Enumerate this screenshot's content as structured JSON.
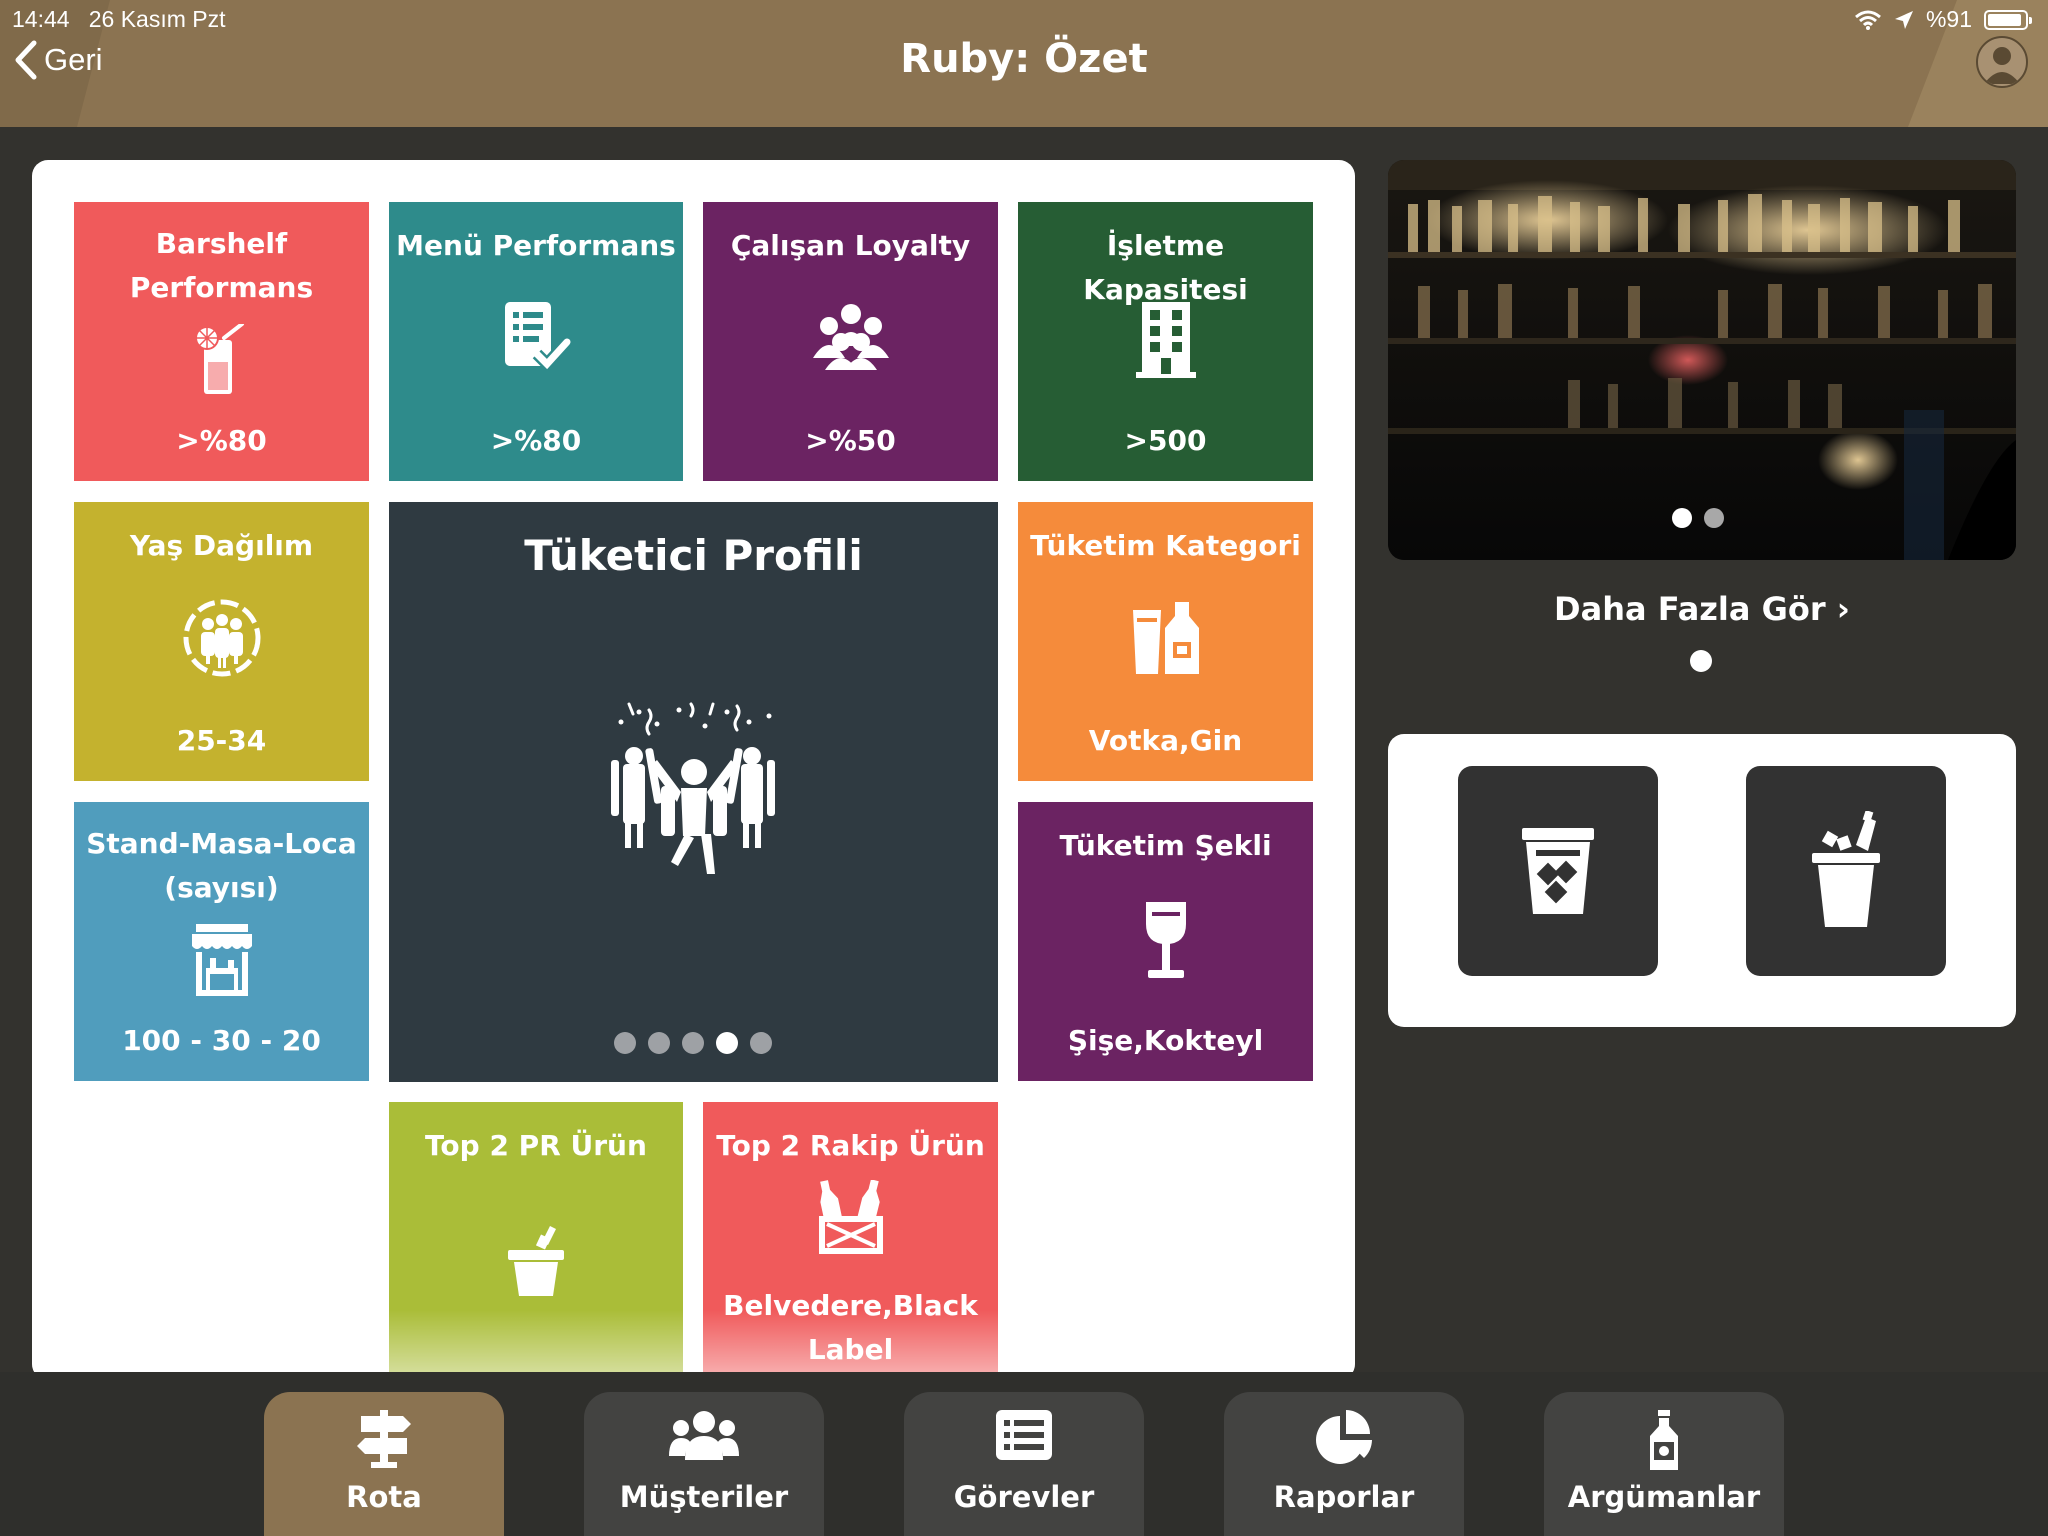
{
  "status_bar": {
    "time": "14:44",
    "date": "26 Kasım Pzt",
    "battery": "%91",
    "battery_level_percent": 91
  },
  "header": {
    "back_label": "Geri",
    "title": "Ruby: Özet"
  },
  "tiles": {
    "barshelf": {
      "title": "Barshelf Performans",
      "value": ">%80",
      "color": "#f05a5b",
      "icon": "cocktail-glass-icon"
    },
    "menu": {
      "title": "Menü Performans",
      "value": ">%80",
      "color": "#2e8b8b",
      "icon": "checklist-icon"
    },
    "loyalty": {
      "title": "Çalışan Loyalty",
      "value": ">%50",
      "color": "#6b2362",
      "icon": "group-icon"
    },
    "capacity": {
      "title": "İşletme Kapasitesi",
      "value": ">500",
      "color": "#265d34",
      "icon": "building-icon"
    },
    "age": {
      "title": "Yaş Dağılım",
      "value": "25-34",
      "color": "#c4b22e",
      "icon": "crowd-circle-icon"
    },
    "consumer": {
      "title": "Tüketici Profili",
      "color": "#2f3a41",
      "icon": "party-crowd-icon",
      "page_count": 5,
      "active_page": 4
    },
    "category": {
      "title": "Tüketim Kategori",
      "value": "Votka,Gin",
      "color": "#f58b3b",
      "icon": "glass-bottle-icon"
    },
    "stand": {
      "title": "Stand-Masa-Loca (sayısı)",
      "value": "100 - 30 - 20",
      "color": "#509dbd",
      "icon": "shop-icon"
    },
    "shape": {
      "title": "Tüketim Şekli",
      "value": "Şişe,Kokteyl",
      "color": "#6b2362",
      "icon": "wine-glass-icon"
    },
    "top_pr": {
      "title": "Top 2 PR Ürün",
      "color": "#aabd38",
      "icon": "ice-bucket-icon"
    },
    "top_rival": {
      "title": "Top 2 Rakip Ürün",
      "value": "Belvedere,Black Label",
      "color": "#f05a5b",
      "icon": "bottles-crate-icon"
    }
  },
  "photo": {
    "page_count": 2,
    "active_page": 1
  },
  "more": {
    "label": "Daha Fazla Gör ›"
  },
  "quick_buttons": [
    {
      "icon": "ice-glass-icon"
    },
    {
      "icon": "ice-bucket-bottle-icon"
    }
  ],
  "bottom_nav": [
    {
      "label": "Rota",
      "icon": "signpost-icon",
      "active": true
    },
    {
      "label": "Müşteriler",
      "icon": "users-icon",
      "active": false
    },
    {
      "label": "Görevler",
      "icon": "task-list-icon",
      "active": false
    },
    {
      "label": "Raporlar",
      "icon": "pie-chart-icon",
      "active": false
    },
    {
      "label": "Argümanlar",
      "icon": "bottle-icon",
      "active": false
    }
  ]
}
